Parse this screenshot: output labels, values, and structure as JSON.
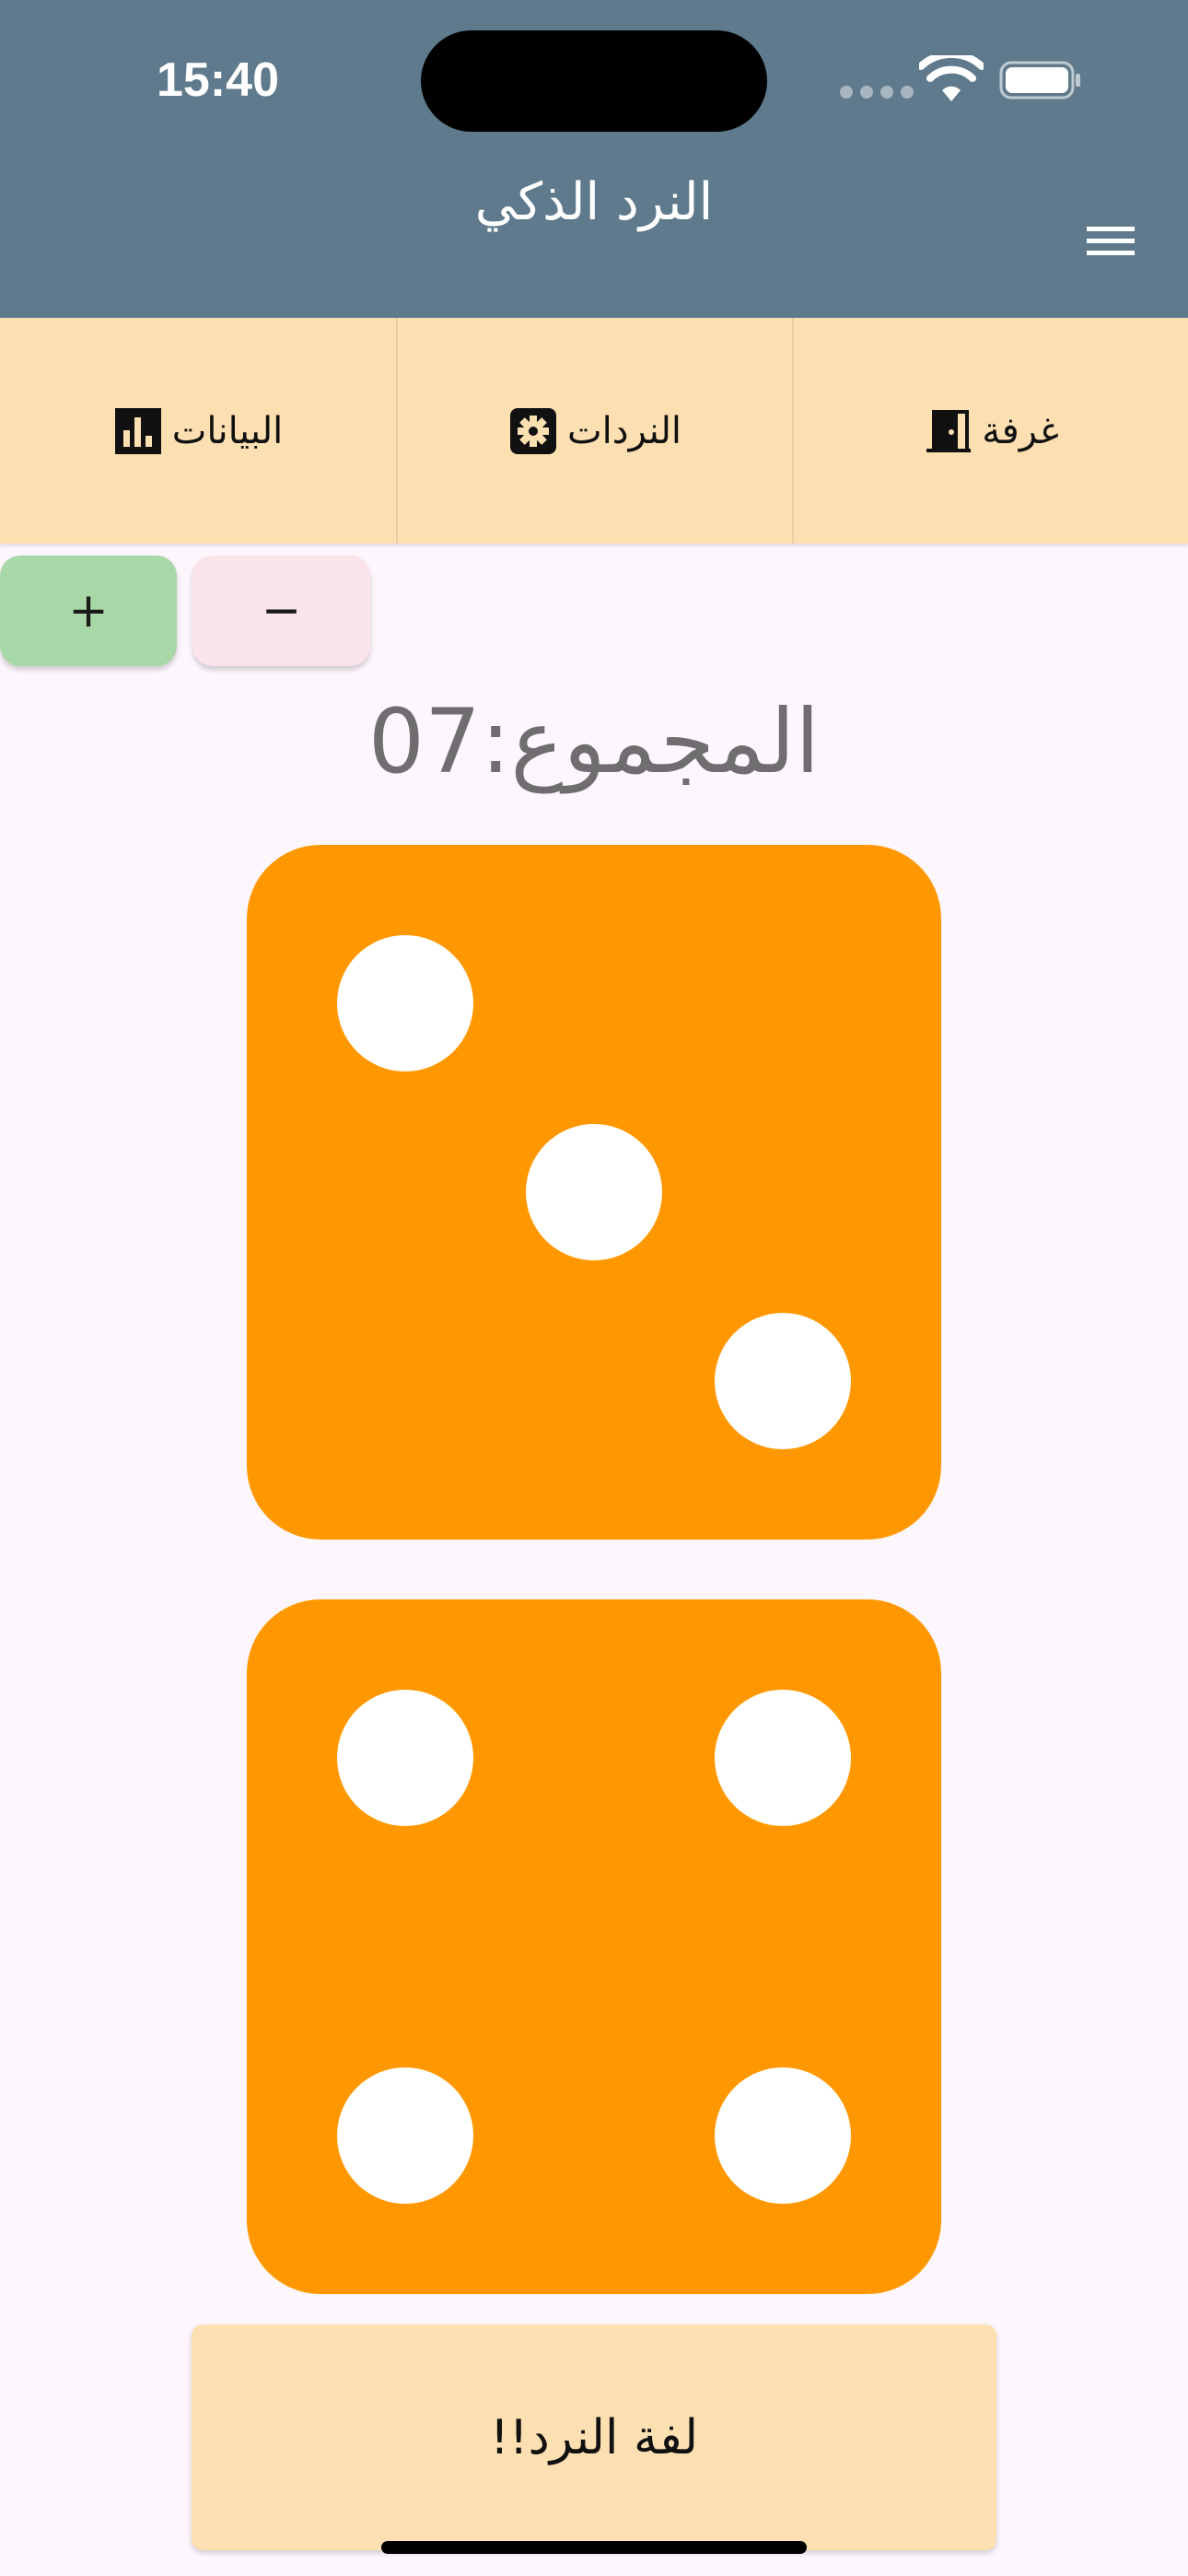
{
  "status_bar": {
    "time": "15:40"
  },
  "header": {
    "title": "النرد الذكي",
    "menu_icon": "hamburger-menu-icon",
    "background": "#5f7a8c"
  },
  "tabs": [
    {
      "label": "البيانات",
      "icon": "bar-chart-icon"
    },
    {
      "label": "النردات",
      "icon": "settings-gear-icon"
    },
    {
      "label": "غرفة",
      "icon": "door-icon"
    }
  ],
  "stepper": {
    "plus_label": "+",
    "minus_label": "−",
    "plus_color": "#a9d8a8",
    "minus_color": "#fbe3ea"
  },
  "total": {
    "text": "المجموع:07"
  },
  "dice": [
    {
      "value": 3,
      "color": "#ff9800"
    },
    {
      "value": 4,
      "color": "#ff9800"
    }
  ],
  "roll_button": {
    "label": "لفة النرد!!"
  }
}
